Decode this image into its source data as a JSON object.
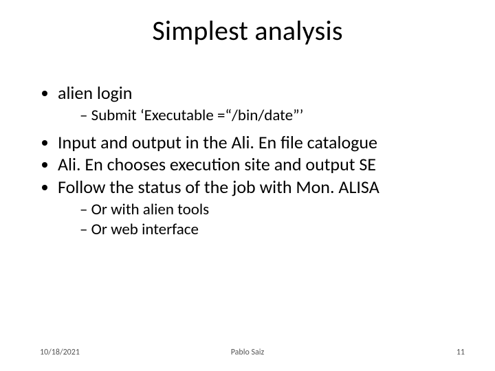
{
  "title": "Simplest analysis",
  "bullets": {
    "b1": "alien  login",
    "b1_sub1": "Submit ‘Executable =“/bin/date”’",
    "b2": "Input and output in the Ali. En file catalogue",
    "b3": "Ali. En chooses execution site and output SE",
    "b4": "Follow the status of the job with  Mon. ALISA",
    "b4_sub1": "Or with alien tools",
    "b4_sub2": "Or web interface"
  },
  "footer": {
    "date": "10/18/2021",
    "author": "Pablo Saiz",
    "page": "11"
  }
}
